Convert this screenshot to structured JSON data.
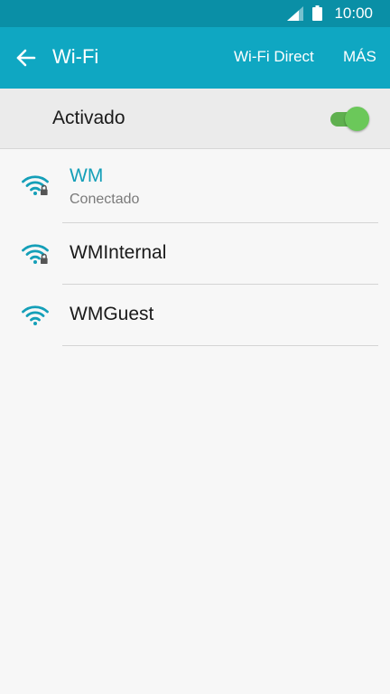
{
  "status_bar": {
    "time": "10:00"
  },
  "app_bar": {
    "title": "Wi-Fi",
    "wifi_direct_label": "Wi-Fi Direct",
    "more_label": "MÁS"
  },
  "toggle": {
    "label": "Activado",
    "state": "on"
  },
  "networks": [
    {
      "name": "WM",
      "status": "Conectado",
      "secured": true,
      "connected": true
    },
    {
      "name": "WMInternal",
      "status": "",
      "secured": true,
      "connected": false
    },
    {
      "name": "WMGuest",
      "status": "",
      "secured": false,
      "connected": false
    }
  ],
  "colors": {
    "status_bar": "#0a8fa6",
    "app_bar": "#0fa7c2",
    "accent": "#149fb8",
    "toggle_on": "#6bc85a"
  }
}
